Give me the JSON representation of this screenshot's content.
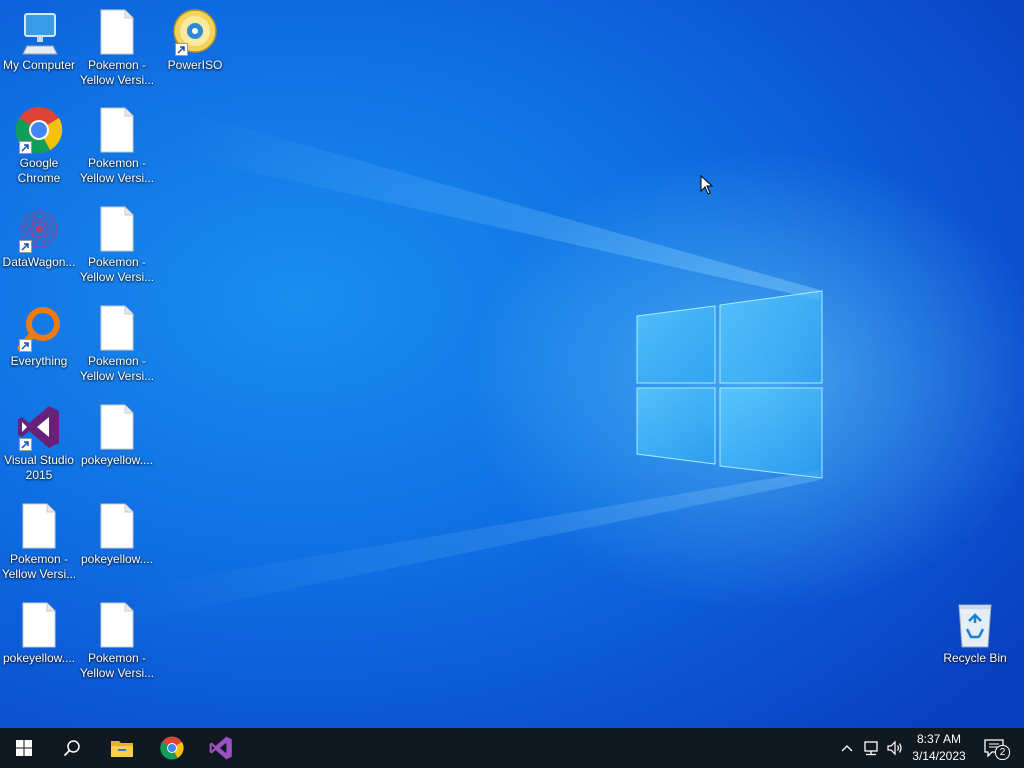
{
  "desktop": {
    "icons": [
      {
        "label": "My Computer"
      },
      {
        "label": "Pokemon -\nYellow Versi..."
      },
      {
        "label": "PowerISO"
      },
      {
        "label": "Google\nChrome"
      },
      {
        "label": "Pokemon -\nYellow Versi..."
      },
      {
        "label": "DataWagon..."
      },
      {
        "label": "Pokemon -\nYellow Versi..."
      },
      {
        "label": "Everything"
      },
      {
        "label": "Pokemon -\nYellow Versi..."
      },
      {
        "label": "Visual Studio\n2015"
      },
      {
        "label": "pokeyellow...."
      },
      {
        "label": "Pokemon -\nYellow Versi..."
      },
      {
        "label": "pokeyellow...."
      },
      {
        "label": "pokeyellow...."
      },
      {
        "label": "Pokemon -\nYellow Versi..."
      },
      {
        "label": "Recycle Bin"
      }
    ]
  },
  "taskbar": {
    "clock": {
      "time": "8:37 AM",
      "date": "3/14/2023"
    },
    "notification_count": "2",
    "pinned": [
      "start-icon",
      "search-icon",
      "file-explorer-icon",
      "chrome-icon",
      "visual-studio-icon"
    ],
    "tray": [
      "chevron-up-icon",
      "network-icon",
      "volume-icon",
      "notification-icon"
    ]
  },
  "colors": {
    "taskbar_bg": "#101820",
    "desktop_bg": "#0f6ee2",
    "windows_blue": "#0078d7"
  }
}
